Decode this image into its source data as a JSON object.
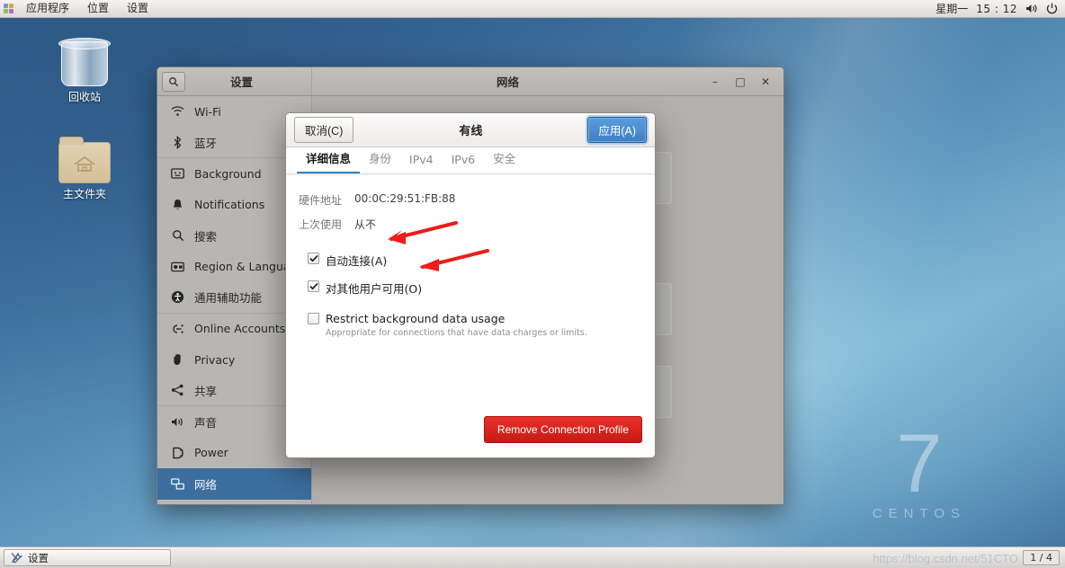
{
  "top_panel": {
    "menus": [
      {
        "label": "应用程序",
        "name": "applications-menu"
      },
      {
        "label": "位置",
        "name": "places-menu"
      },
      {
        "label": "设置",
        "name": "system-menu"
      }
    ],
    "day": "星期一",
    "clock": "15 : 12",
    "volume_icon": "volume-icon",
    "power_icon": "power-icon"
  },
  "desktop": {
    "icons": [
      {
        "label": "回收站",
        "name": "trash-icon"
      },
      {
        "label": "主文件夹",
        "name": "home-folder-icon"
      }
    ],
    "brand_version": "7",
    "brand_name": "CENTOS"
  },
  "settings_window": {
    "sidebar_title": "设置",
    "search_icon": "search-icon",
    "window_title": "网络",
    "window_buttons": {
      "minimize": "–",
      "maximize": "□",
      "close": "✕"
    },
    "sidebar_items": [
      {
        "label": "Wi-Fi",
        "icon": "wifi-icon"
      },
      {
        "label": "蓝牙",
        "icon": "bluetooth-icon"
      },
      {
        "label": "Background",
        "icon": "background-icon"
      },
      {
        "label": "Notifications",
        "icon": "bell-icon"
      },
      {
        "label": "搜索",
        "icon": "search-icon"
      },
      {
        "label": "Region & Language",
        "icon": "region-icon"
      },
      {
        "label": "通用辅助功能",
        "icon": "accessibility-icon"
      },
      {
        "label": "Online Accounts",
        "icon": "online-accounts-icon"
      },
      {
        "label": "Privacy",
        "icon": "privacy-hand-icon"
      },
      {
        "label": "共享",
        "icon": "share-icon"
      },
      {
        "label": "声音",
        "icon": "sound-icon"
      },
      {
        "label": "Power",
        "icon": "power-plug-icon"
      },
      {
        "label": "网络",
        "icon": "network-icon"
      }
    ],
    "selected_sidebar_item": "网络",
    "add_button_label": "+"
  },
  "dialog": {
    "cancel_label": "取消(C)",
    "title": "有线",
    "apply_label": "应用(A)",
    "tabs": [
      {
        "label": "详细信息",
        "active": true
      },
      {
        "label": "身份",
        "active": false
      },
      {
        "label": "IPv4",
        "active": false
      },
      {
        "label": "IPv6",
        "active": false
      },
      {
        "label": "安全",
        "active": false
      }
    ],
    "details": [
      {
        "key": "硬件地址",
        "value": "00:0C:29:51:FB:88"
      },
      {
        "key": "上次使用",
        "value": "从不"
      }
    ],
    "checkboxes": [
      {
        "label": "自动连接(A)",
        "checked": true,
        "sub": ""
      },
      {
        "label": "对其他用户可用(O)",
        "checked": true,
        "sub": ""
      },
      {
        "label": "Restrict background data usage",
        "checked": false,
        "sub": "Appropriate for connections that have data charges or limits."
      }
    ],
    "remove_label": "Remove Connection Profile"
  },
  "bottom_panel": {
    "task_label": "设置",
    "task_icon": "tools-icon",
    "workspace": "1 / 4",
    "watermark": "https://blog.csdn.net/51CTO"
  },
  "colors": {
    "accent_blue": "#3c6e9f",
    "apply_blue": "#3d7fc1",
    "danger_red": "#c81a15",
    "arrow_red": "#ee1c1c"
  }
}
